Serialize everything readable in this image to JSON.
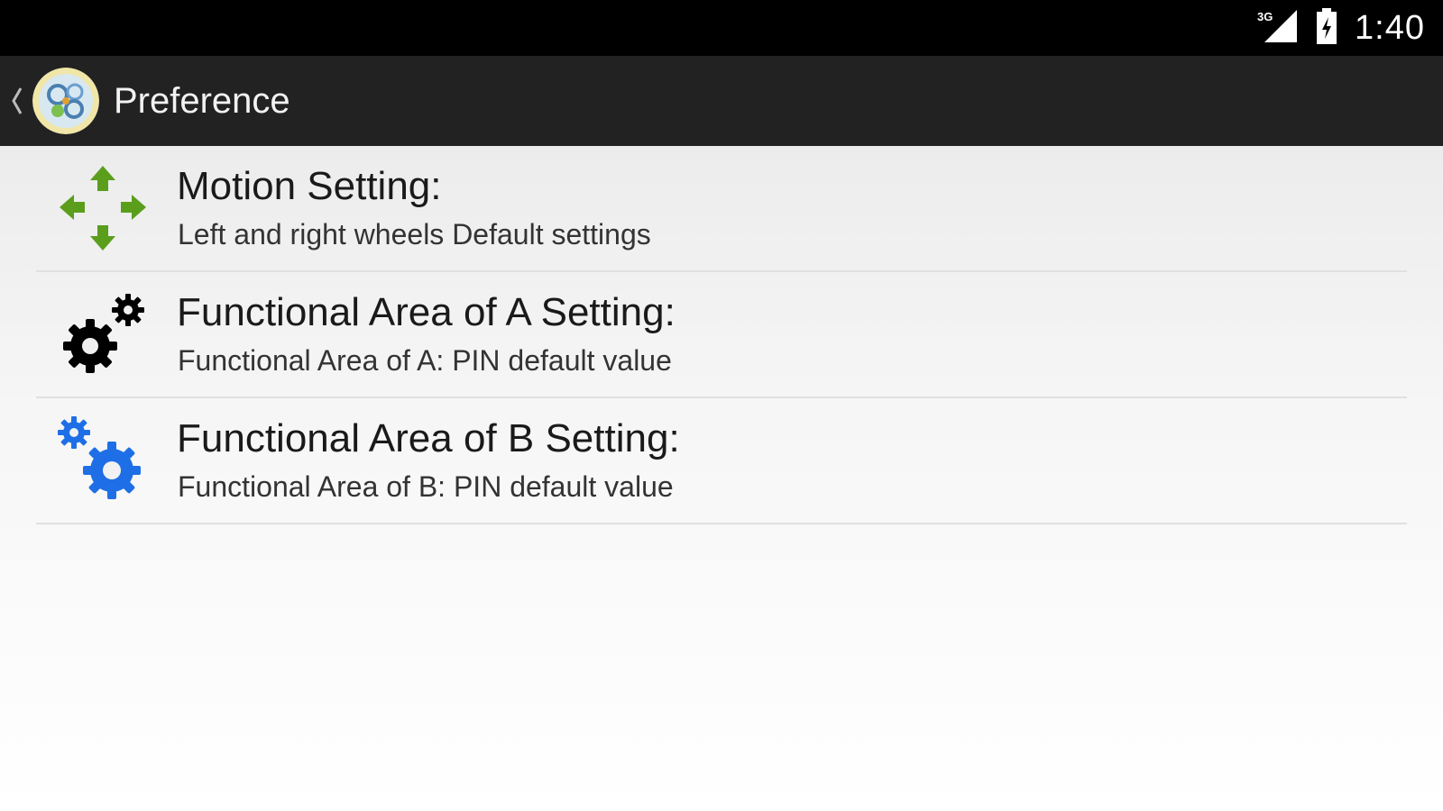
{
  "status_bar": {
    "network_label": "3G",
    "time": "1:40"
  },
  "action_bar": {
    "title": "Preference",
    "up_icon": "chevron-left-icon",
    "app_icon": "app-logo-icon"
  },
  "preferences": [
    {
      "title": "Motion Setting:",
      "summary": "Left and right wheels Default settings",
      "icon": "move-arrows-icon",
      "icon_color": "#5a9e1c"
    },
    {
      "title": "Functional Area of A Setting:",
      "summary": "Functional Area of A: PIN default value",
      "icon": "gears-icon",
      "icon_color": "#000000"
    },
    {
      "title": "Functional Area of B Setting:",
      "summary": "Functional Area of B: PIN default value",
      "icon": "gears-icon",
      "icon_color": "#1e6fe6"
    }
  ],
  "colors": {
    "status_bar_bg": "#000000",
    "action_bar_bg": "#222222",
    "divider": "#e0e0e0"
  }
}
